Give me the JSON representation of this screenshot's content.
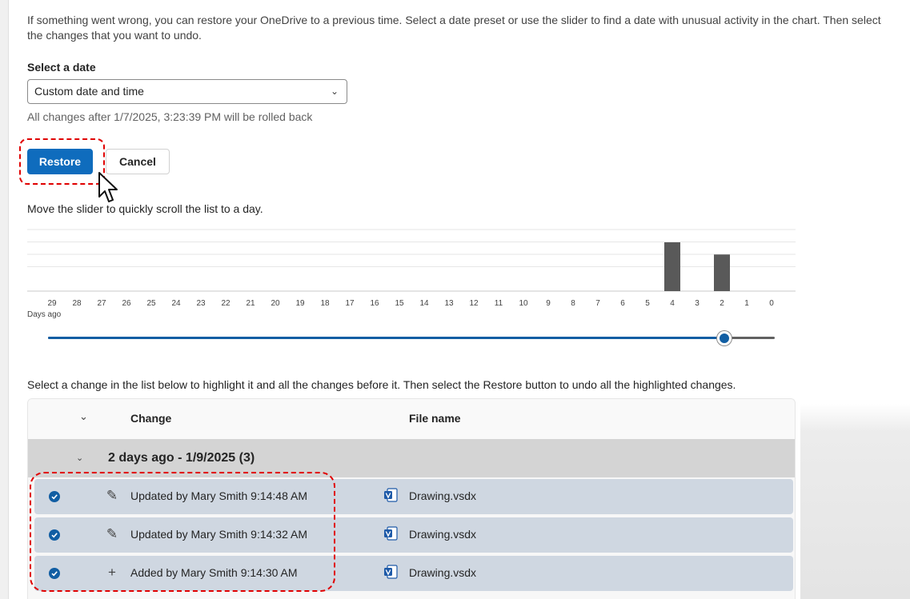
{
  "intro": "If something went wrong, you can restore your OneDrive to a previous time. Select a date preset or use the slider to find a date with unusual activity in the chart. Then select the changes that you want to undo.",
  "date": {
    "label": "Select a date",
    "selected": "Custom date and time",
    "rollback_note": "All changes after 1/7/2025, 3:23:39 PM will be rolled back"
  },
  "buttons": {
    "restore": "Restore",
    "cancel": "Cancel"
  },
  "slider_hint": "Move the slider to quickly scroll the list to a day.",
  "chart_data": {
    "type": "bar",
    "categories": [
      "29",
      "28",
      "27",
      "26",
      "25",
      "24",
      "23",
      "22",
      "21",
      "20",
      "19",
      "18",
      "17",
      "16",
      "15",
      "14",
      "13",
      "12",
      "11",
      "10",
      "9",
      "8",
      "7",
      "6",
      "5",
      "4",
      "3",
      "2",
      "1",
      "0"
    ],
    "values": [
      0,
      0,
      0,
      0,
      0,
      0,
      0,
      0,
      0,
      0,
      0,
      0,
      0,
      0,
      0,
      0,
      0,
      0,
      0,
      0,
      0,
      0,
      0,
      0,
      0,
      4,
      0,
      3,
      0,
      0
    ],
    "xlabel": "Days ago",
    "ylabel": "",
    "ylim": [
      0,
      4
    ],
    "grid": true,
    "bar_color": "#595959"
  },
  "slider": {
    "value_days_ago": 2
  },
  "list_hint": "Select a change in the list below to highlight it and all the changes before it. Then select the Restore button to undo all the highlighted changes.",
  "table": {
    "columns": {
      "change": "Change",
      "file": "File name"
    },
    "group": {
      "title": "2 days ago - 1/9/2025 (3)"
    },
    "rows": [
      {
        "icon": "pencil-icon",
        "change": "Updated by Mary Smith 9:14:48 AM",
        "file": "Drawing.vsdx"
      },
      {
        "icon": "pencil-icon",
        "change": "Updated by Mary Smith 9:14:32 AM",
        "file": "Drawing.vsdx"
      },
      {
        "icon": "plus-icon",
        "change": "Added by Mary Smith 9:14:30 AM",
        "file": "Drawing.vsdx"
      }
    ]
  },
  "colors": {
    "accent": "#0f6cbd",
    "highlight": "#e00000",
    "row_selected": "#cfd7e1"
  }
}
